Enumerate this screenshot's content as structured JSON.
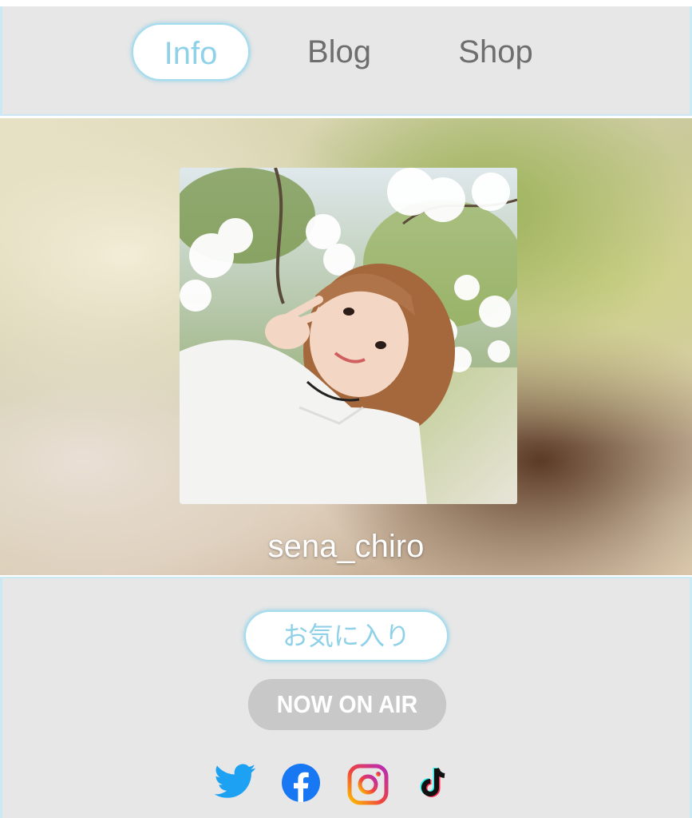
{
  "nav": {
    "tabs": [
      {
        "label": "Info",
        "active": true
      },
      {
        "label": "Blog",
        "active": false
      },
      {
        "label": "Shop",
        "active": false
      }
    ]
  },
  "profile": {
    "username": "sena_chiro"
  },
  "actions": {
    "favorite_label": "お気に入り",
    "now_on_air_label": "NOW ON AIR"
  },
  "social": [
    {
      "icon": "twitter-icon",
      "color": "#1da1f2"
    },
    {
      "icon": "facebook-icon",
      "color": "#1877f2"
    },
    {
      "icon": "instagram-icon",
      "color": "#e1306c"
    },
    {
      "icon": "tiktok-icon",
      "color": "#111111"
    }
  ],
  "colors": {
    "accent": "#8fd1e8",
    "panel_bg": "#e7e7e7",
    "onair_bg": "#c8c8c8"
  }
}
